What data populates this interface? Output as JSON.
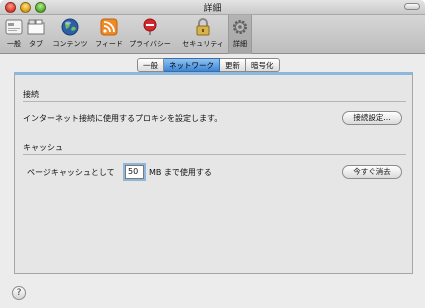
{
  "window": {
    "title": "詳細"
  },
  "toolbar": {
    "items": [
      {
        "label": "一般",
        "icon": "general-switch-icon"
      },
      {
        "label": "タブ",
        "icon": "tabs-icon"
      },
      {
        "label": "コンテンツ",
        "icon": "globe-icon"
      },
      {
        "label": "フィード",
        "icon": "rss-feed-icon"
      },
      {
        "label": "プライバシー",
        "icon": "privacy-sign-icon"
      },
      {
        "label": "セキュリティ",
        "icon": "lock-icon"
      },
      {
        "label": "詳細",
        "icon": "gear-icon",
        "selected": true
      }
    ]
  },
  "tabs": [
    {
      "label": "一般"
    },
    {
      "label": "ネットワーク",
      "active": true
    },
    {
      "label": "更新"
    },
    {
      "label": "暗号化"
    }
  ],
  "connection": {
    "heading": "接続",
    "description": "インターネット接続に使用するプロキシを設定します。",
    "button": "接続設定..."
  },
  "cache": {
    "heading": "キャッシュ",
    "label_before": "ページキャッシュとして",
    "value": "50",
    "label_after": "MB まで使用する",
    "button": "今すぐ消去"
  },
  "help": {
    "label": "?"
  },
  "colors": {
    "accent": "#3d87d6",
    "pane_border": "#8fb7de"
  }
}
